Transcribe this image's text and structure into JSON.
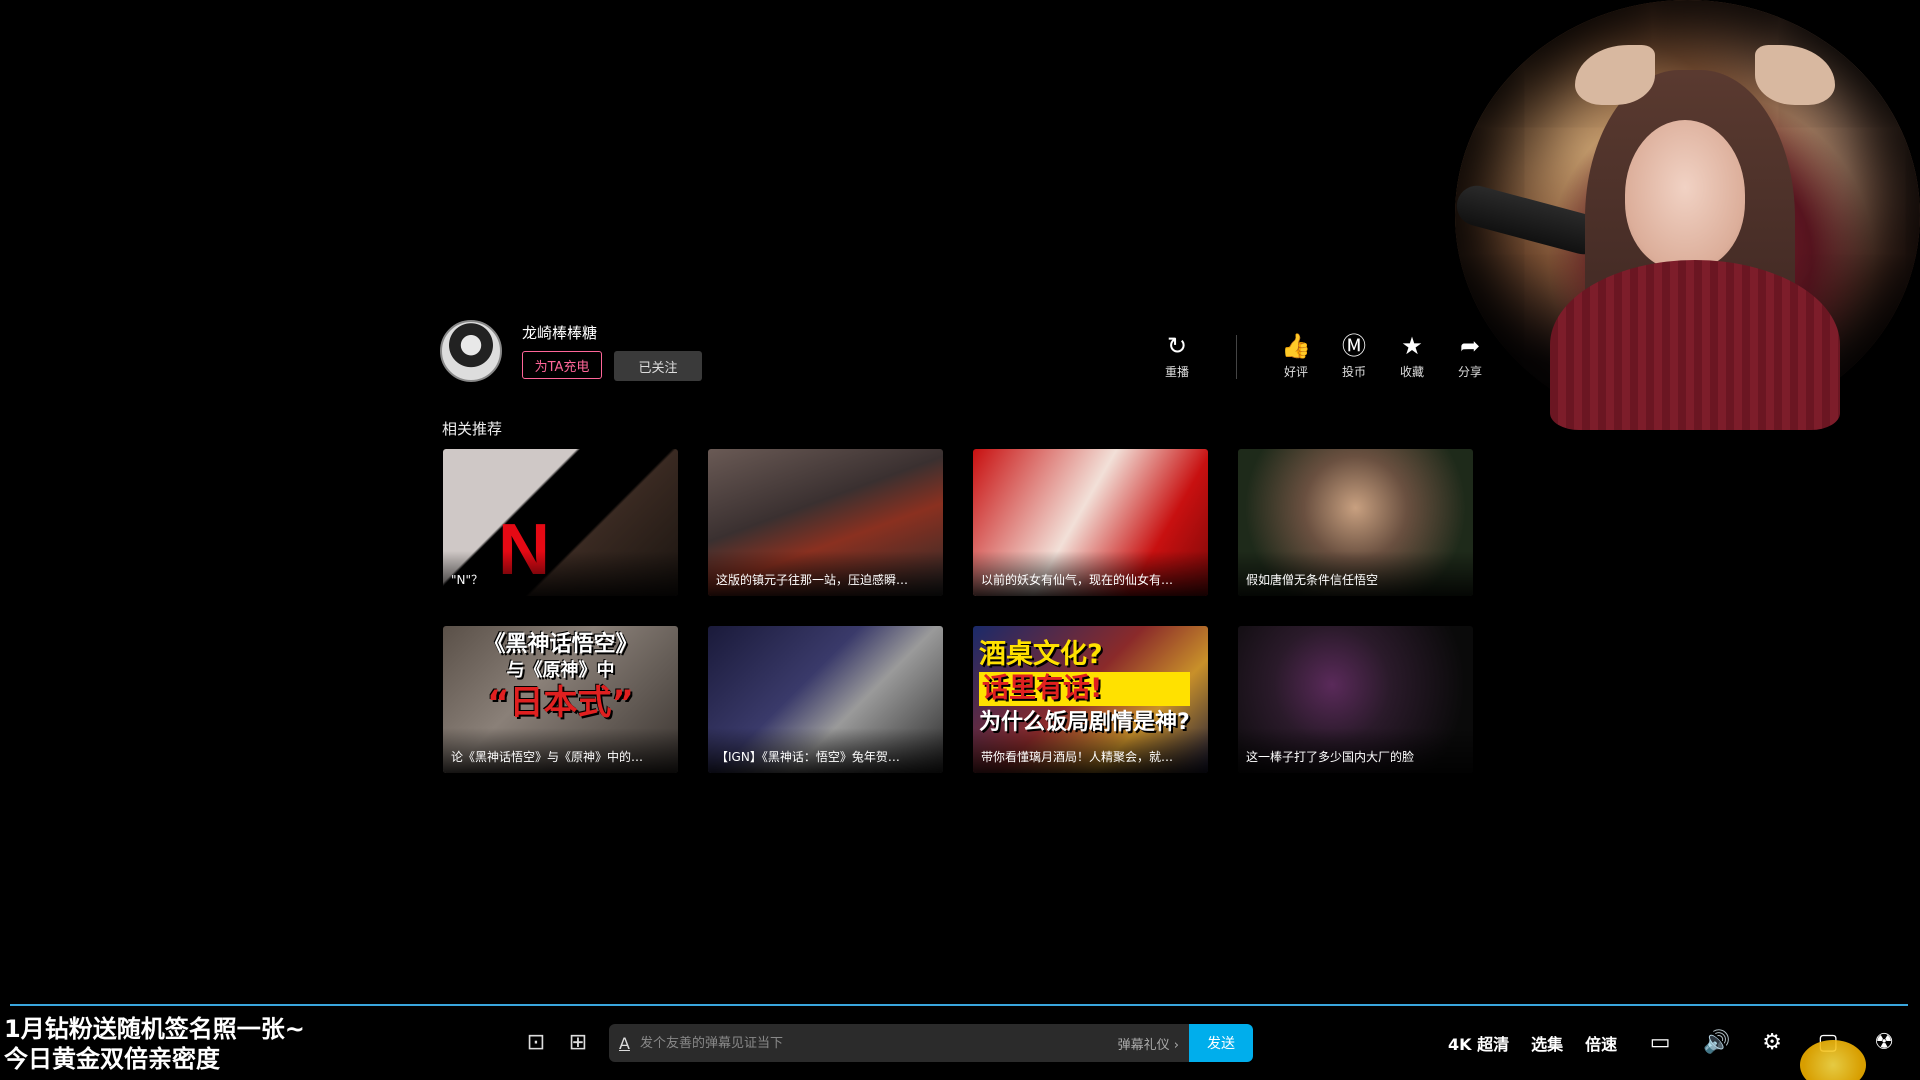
{
  "uploader": {
    "name": "龙崎棒棒糖",
    "charge_label": "为TA充电",
    "follow_label": "已关注"
  },
  "actions": [
    {
      "label": "重播",
      "icon": "replay-icon",
      "glyph": "↻"
    },
    {
      "label": "好评",
      "icon": "thumbs-up-icon",
      "glyph": "👍"
    },
    {
      "label": "投币",
      "icon": "coin-icon",
      "glyph": "Ⓜ"
    },
    {
      "label": "收藏",
      "icon": "star-icon",
      "glyph": "★"
    },
    {
      "label": "分享",
      "icon": "share-icon",
      "glyph": "➦"
    }
  ],
  "related": {
    "title": "相关推荐",
    "videos": [
      {
        "caption": "\"N\"？",
        "bg": "linear-gradient(135deg,#cfc8c6 0%,#cfc8c6 35%,#000 36%,#000 60%,#3a2a22 61%,#1a1410 100%)"
      },
      {
        "caption": "这版的镇元子往那一站，压迫感瞬…",
        "bg": "linear-gradient(160deg,#6a5a55 0%,#3a3030 40%,#8a3020 60%,#2a2a2a 100%)"
      },
      {
        "caption": "以前的妖女有仙气，现在的仙女有…",
        "bg": "linear-gradient(120deg,#c81010 0%,#f2e0d8 45%,#c81010 75%,#7a0808 100%)"
      },
      {
        "caption": "假如唐僧无条件信任悟空",
        "bg": "radial-gradient(circle at 50% 40%,#c8a080 0%,#6a5040 35%,#1e2a1a 75%)"
      },
      {
        "caption": "论《黑神话悟空》与《原神》中的…",
        "bg": "linear-gradient(135deg,#5a5048 0%,#8a8078 40%,#3a3430 100%)",
        "overlay": "《黑神话悟空》",
        "overlay2": "与《原神》中",
        "overlay3": "“日本式”"
      },
      {
        "caption": "【IGN】《黑神话：悟空》兔年贺…",
        "bg": "linear-gradient(135deg,#1a1a3a 0%,#3a3a6a 40%,#9a9a9a 60%,#2a2a2a 100%)"
      },
      {
        "caption": "带你看懂璃月酒局！人精聚会，就…",
        "bg": "linear-gradient(135deg,#1a2a6a 0%,#8a2a2a 45%,#c8902a 70%,#1a1a3a 100%)",
        "overlay": "酒桌文化?",
        "overlay2": "话里有话!",
        "overlay3": "为什么饭局剧情是神?"
      },
      {
        "caption": "这一棒子打了多少国内大厂的脸",
        "bg": "radial-gradient(circle at 40% 40%,#5a2a5a 0%,#2a1a2a 35%,#0a0a0a 80%)"
      }
    ]
  },
  "promo": {
    "line1": "1月钻粉送随机签名照一张~",
    "line2": "今日黄金双倍亲密度"
  },
  "danmaku": {
    "placeholder": "发个友善的弹幕见证当下",
    "etiquette": "弹幕礼仪 ›",
    "send": "发送"
  },
  "controls": {
    "quality": "4K 超清",
    "episodes": "选集",
    "speed": "倍速"
  }
}
